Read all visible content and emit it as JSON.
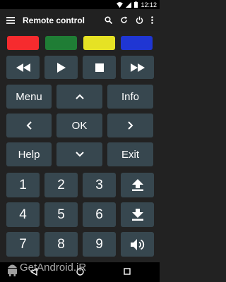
{
  "status": {
    "time": "12:12"
  },
  "toolbar": {
    "title": "Remote control",
    "icons": [
      "menu-icon",
      "search-icon",
      "refresh-icon",
      "power-icon",
      "more-icon"
    ]
  },
  "colors": {
    "red": "#f62b2e",
    "green": "#1f7d35",
    "yellow": "#e6e224",
    "blue": "#1f36d3",
    "key_bg": "#37474f",
    "bg": "#222222"
  },
  "playback": {
    "icons": [
      "rewind-icon",
      "play-icon",
      "stop-icon",
      "fast-forward-icon"
    ]
  },
  "nav": {
    "menu": "Menu",
    "info": "Info",
    "ok": "OK",
    "help": "Help",
    "exit": "Exit"
  },
  "numbers": [
    "1",
    "2",
    "3",
    "4",
    "5",
    "6",
    "7",
    "8",
    "9"
  ],
  "side_icons": [
    "channel-up-icon",
    "channel-down-icon",
    "volume-icon"
  ],
  "watermark": "GetAndroid.iR"
}
